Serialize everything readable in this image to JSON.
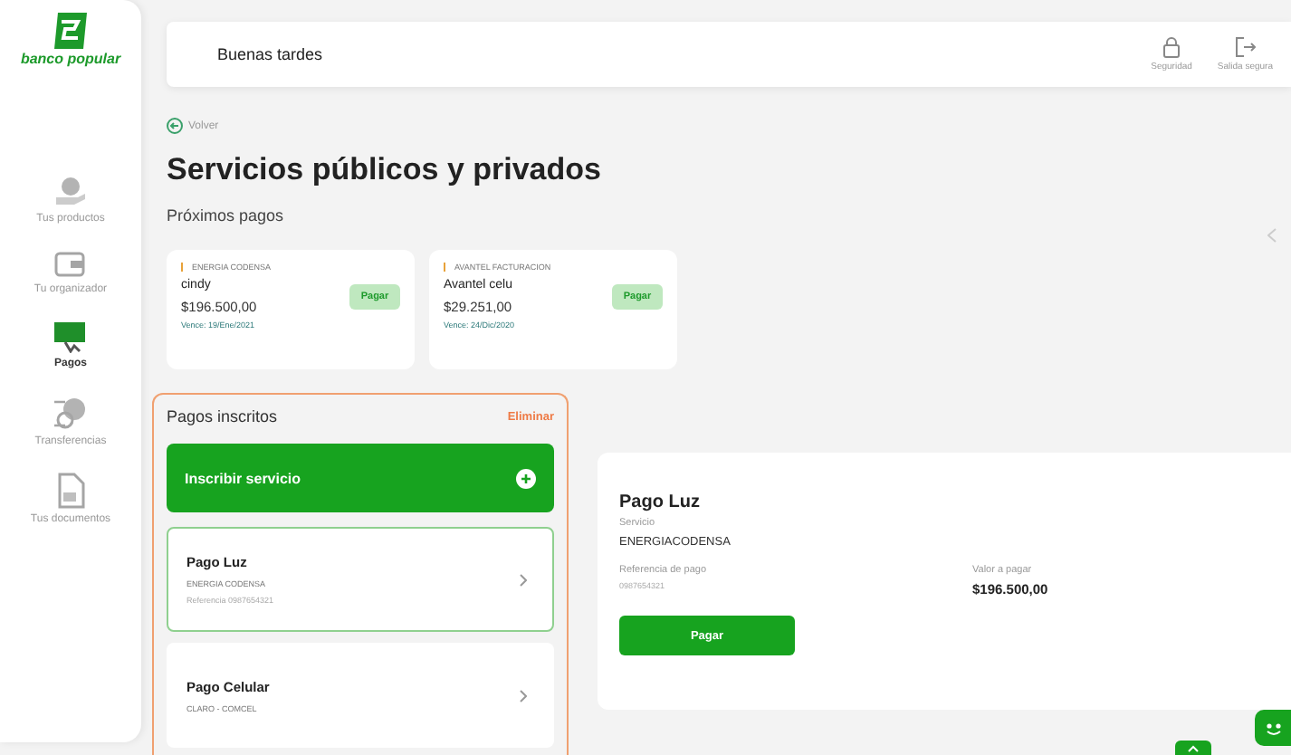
{
  "logo": {
    "text": "banco popular"
  },
  "sidebar": {
    "items": [
      {
        "label": "Tus productos",
        "selected": false
      },
      {
        "label": "Tu organizador",
        "selected": false
      },
      {
        "label": "Pagos",
        "selected": true
      },
      {
        "label": "Transferencias",
        "selected": false
      },
      {
        "label": "Tus documentos",
        "selected": false
      }
    ]
  },
  "header": {
    "greeting": "Buenas tardes",
    "actions": [
      {
        "label": "Seguridad"
      },
      {
        "label": "Salida segura"
      }
    ]
  },
  "back_link": "Volver",
  "title": "Servicios públicos y privados",
  "upcoming": {
    "heading": "Próximos pagos",
    "cards": [
      {
        "company": "ENERGIA CODENSA",
        "name": "cindy",
        "amount": "$196.500,00",
        "due": "Vence: 19/Ene/2021",
        "button": "Pagar"
      },
      {
        "company": "AVANTEL FACTURACION",
        "name": "Avantel celu",
        "amount": "$29.251,00",
        "due": "Vence: 24/Dic/2020",
        "button": "Pagar"
      }
    ]
  },
  "enrolled": {
    "heading": "Pagos inscritos",
    "delete": "Eliminar",
    "add_button": "Inscribir servicio",
    "items": [
      {
        "title": "Pago Luz",
        "company": "ENERGIA CODENSA",
        "reference": "Referencia 0987654321",
        "selected": true
      },
      {
        "title": "Pago Celular",
        "company": "CLARO - COMCEL",
        "selected": false
      }
    ]
  },
  "detail": {
    "title": "Pago Luz",
    "service_label": "Servicio",
    "service": "ENERGIACODENSA",
    "reference_label": "Referencia de pago",
    "reference": "0987654321",
    "amount_label": "Valor a pagar",
    "amount": "$196.500,00",
    "button": "Pagar"
  }
}
